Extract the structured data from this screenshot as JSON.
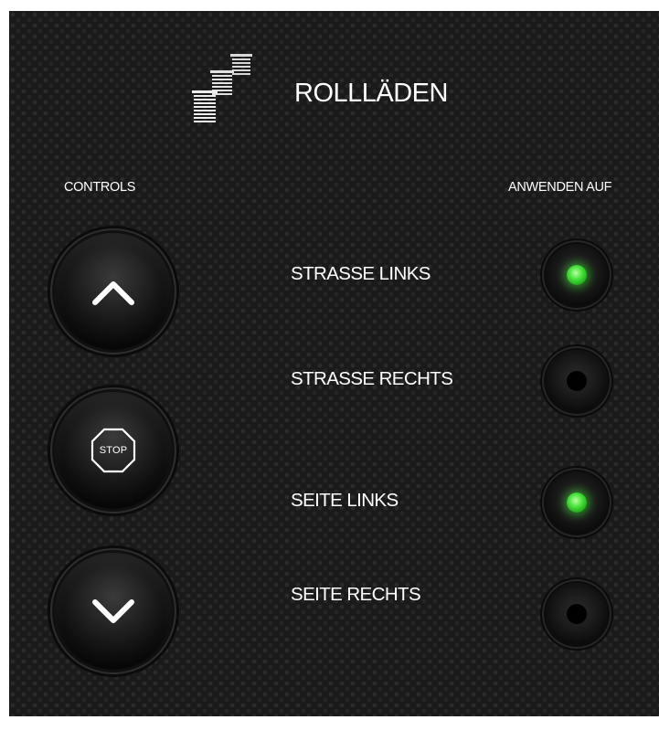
{
  "header": {
    "title": "ROLLLÄDEN",
    "icon": "roller-shutters-icon"
  },
  "controls": {
    "heading": "CONTROLS",
    "buttons": [
      {
        "name": "up",
        "icon": "chevron-up-icon"
      },
      {
        "name": "stop",
        "icon": "stop-sign-icon",
        "label": "STOP"
      },
      {
        "name": "down",
        "icon": "chevron-down-icon"
      }
    ]
  },
  "apply": {
    "heading": "ANWENDEN AUF",
    "zones": [
      {
        "label": "STRASSE LINKS",
        "active": true
      },
      {
        "label": "STRASSE RECHTS",
        "active": false
      },
      {
        "label": "SEITE LINKS",
        "active": true
      },
      {
        "label": "SEITE RECHTS",
        "active": false
      }
    ]
  },
  "colors": {
    "background": "#1a1a1a",
    "text": "#ffffff",
    "led_on": "#46e23a",
    "led_off": "#000000"
  }
}
